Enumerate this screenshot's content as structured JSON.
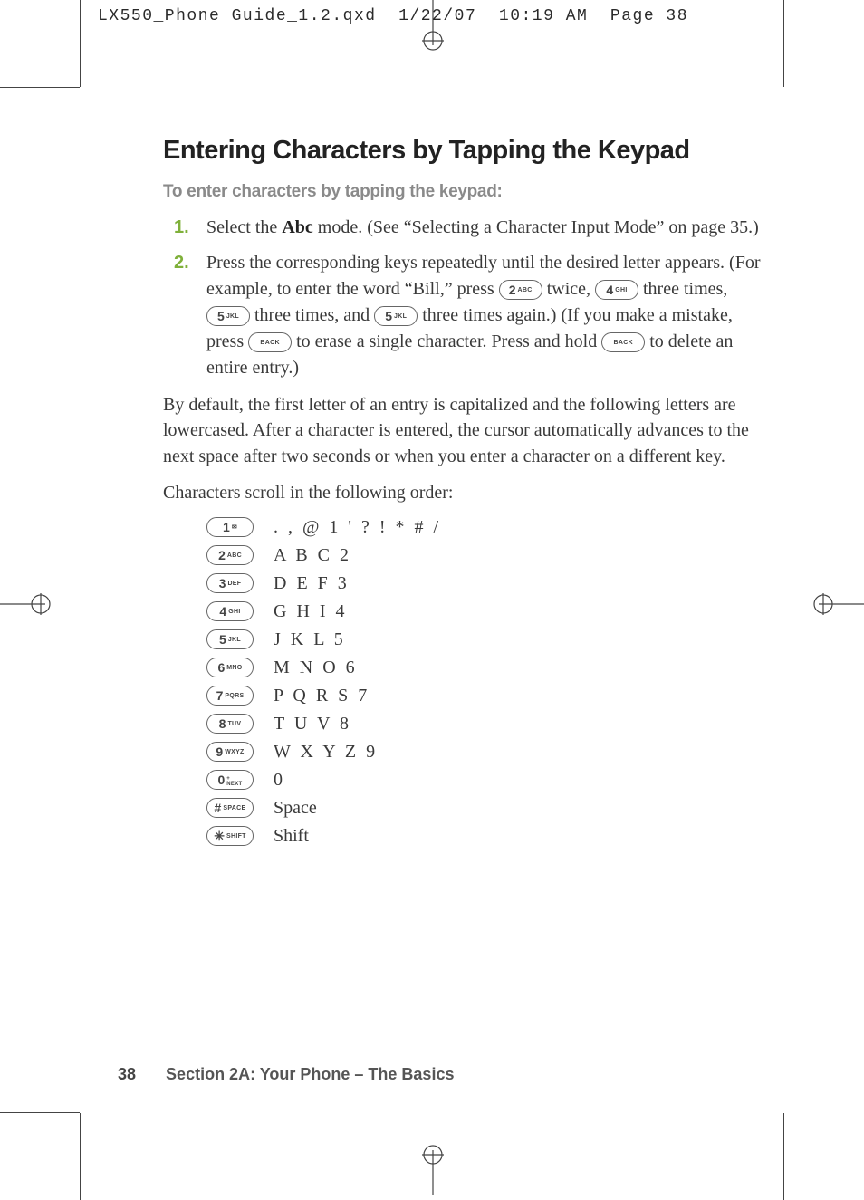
{
  "header": {
    "filename": "LX550_Phone Guide_1.2.qxd",
    "date": "1/22/07",
    "time": "10:19 AM",
    "pagelabel": "Page 38"
  },
  "title": "Entering Characters by Tapping the Keypad",
  "subhead": "To enter characters by tapping the keypad:",
  "steps": {
    "s1_a": "Select the ",
    "s1_b": "Abc",
    "s1_c": " mode. (See “Selecting a Character Input Mode” on page 35.)",
    "s2_a": "Press the corresponding keys repeatedly until the desired letter appears. (For example, to enter the word “Bill,” press ",
    "s2_b": " twice, ",
    "s2_c": " three times, ",
    "s2_d": " three times, and ",
    "s2_e": " three times again.) (If you make a mistake, press ",
    "s2_f": " to erase a single character. Press and hold ",
    "s2_g": " to delete an entire entry.)"
  },
  "keys": {
    "k1": {
      "big": "1",
      "sub": "✉",
      "name": "key-1"
    },
    "k2": {
      "big": "2",
      "sub": "ABC",
      "name": "key-2-abc"
    },
    "k3": {
      "big": "3",
      "sub": "DEF",
      "name": "key-3-def"
    },
    "k4": {
      "big": "4",
      "sub": "GHI",
      "name": "key-4-ghi"
    },
    "k5": {
      "big": "5",
      "sub": "JKL",
      "name": "key-5-jkl"
    },
    "k6": {
      "big": "6",
      "sub": "MNO",
      "name": "key-6-mno"
    },
    "k7": {
      "big": "7",
      "sub": "PQRS",
      "name": "key-7-pqrs"
    },
    "k8": {
      "big": "8",
      "sub": "TUV",
      "name": "key-8-tuv"
    },
    "k9": {
      "big": "9",
      "sub": "WXYZ",
      "name": "key-9-wxyz"
    },
    "k0": {
      "big": "0",
      "sub": "NEXT",
      "name": "key-0-next"
    },
    "khash": {
      "big": "#",
      "sub": "SPACE",
      "name": "key-hash-space"
    },
    "kstar": {
      "big": "✳",
      "sub": "SHIFT",
      "name": "key-star-shift"
    },
    "kback": {
      "big": "",
      "sub": "BACK",
      "name": "key-back"
    }
  },
  "para1": "By default, the first letter of an entry is capitalized and the following letters are lowercased. After a character is entered, the cursor automatically advances to the next space after two seconds or when you enter a character on a different key.",
  "para2": "Characters scroll in the following order:",
  "chartable": [
    {
      "key": "k1",
      "chars": ". , @ 1 ' ? ! * # /",
      "word": false
    },
    {
      "key": "k2",
      "chars": "A B C 2",
      "word": false
    },
    {
      "key": "k3",
      "chars": "D E F 3",
      "word": false
    },
    {
      "key": "k4",
      "chars": "G H I 4",
      "word": false
    },
    {
      "key": "k5",
      "chars": "J K L 5",
      "word": false
    },
    {
      "key": "k6",
      "chars": "M N O 6",
      "word": false
    },
    {
      "key": "k7",
      "chars": "P Q R S 7",
      "word": false
    },
    {
      "key": "k8",
      "chars": "T U V 8",
      "word": false
    },
    {
      "key": "k9",
      "chars": "W X Y Z 9",
      "word": false
    },
    {
      "key": "k0",
      "chars": "0",
      "word": false
    },
    {
      "key": "khash",
      "chars": "Space",
      "word": true
    },
    {
      "key": "kstar",
      "chars": "Shift",
      "word": true
    }
  ],
  "footer": {
    "pagenum": "38",
    "section": "Section 2A: Your Phone – The Basics"
  }
}
